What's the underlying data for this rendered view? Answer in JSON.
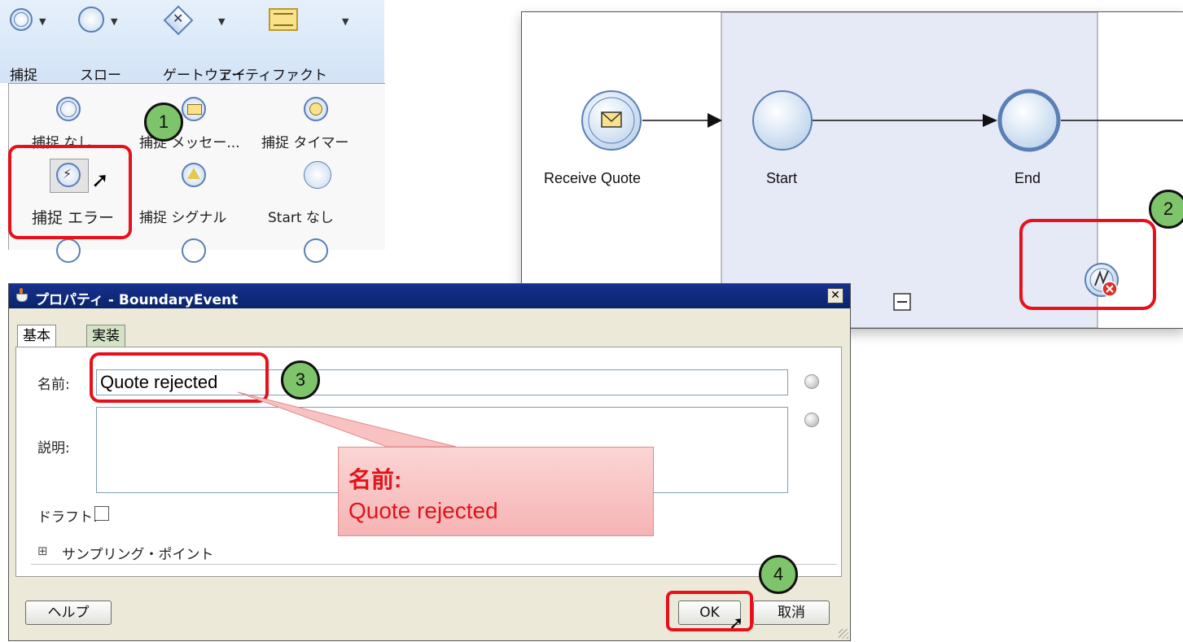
{
  "palette": {
    "toolbar": {
      "catch_label": "捕捉",
      "throw_label": "スロー",
      "gateway_label": "ゲートウェイ",
      "artifact_label": "アーティファクト"
    },
    "items": {
      "catch_none": "捕捉 なし",
      "catch_message": "捕捉 メッセー...",
      "catch_timer": "捕捉 タイマー",
      "catch_error": "捕捉 エラー",
      "catch_signal": "捕捉 シグナル",
      "start_none": "Start なし"
    }
  },
  "canvas": {
    "receive_label": "Receive Quote",
    "start_label": "Start",
    "end_label": "End"
  },
  "dialog": {
    "title": "プロパティ - BoundaryEvent",
    "close_glyph": "✕",
    "tabs": [
      "基本",
      "実装"
    ],
    "name_label": "名前:",
    "name_value": "Quote rejected",
    "description_label": "説明:",
    "description_value": "",
    "draft_label": "ドラフト:",
    "draft_checked": false,
    "sampling_toggle": "⊞",
    "sampling_label": "サンプリング・ポイント",
    "help_button": "ヘルプ",
    "ok_button": "OK",
    "cancel_button": "取消"
  },
  "annotations": {
    "steps": [
      "1",
      "2",
      "3",
      "4"
    ],
    "callout_line1": "名前:",
    "callout_line2": "Quote rejected",
    "highlight_color": "#e8101a",
    "step_color": "#7ec46b"
  }
}
